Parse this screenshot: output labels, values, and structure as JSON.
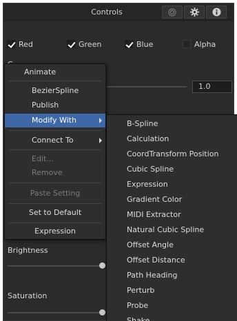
{
  "header": {
    "title": "Controls",
    "buttons": [
      "circles-icon",
      "gear-icon",
      "info-icon"
    ]
  },
  "channels": {
    "red": {
      "label": "Red",
      "checked": true
    },
    "green": {
      "label": "Green",
      "checked": true
    },
    "blue": {
      "label": "Blue",
      "checked": true
    },
    "alpha": {
      "label": "Alpha",
      "checked": false
    }
  },
  "partial_label": "C",
  "value_field": "1.0",
  "sections": {
    "brightness": "Brightness",
    "saturation": "Saturation"
  },
  "context_menu": {
    "animate": "Animate",
    "bezier_spline": "BezierSpline",
    "publish": "Publish",
    "modify_with": "Modify With",
    "connect_to": "Connect To",
    "edit": "Edit...",
    "remove": "Remove",
    "paste_setting": "Paste Setting",
    "set_to_default": "Set to Default",
    "expression": "Expression"
  },
  "submenu": {
    "items": [
      "B-Spline",
      "Calculation",
      "CoordTransform Position",
      "Cubic Spline",
      "Expression",
      "Gradient Color",
      "MIDI Extractor",
      "Natural Cubic Spline",
      "Offset Angle",
      "Offset Distance",
      "Path Heading",
      "Perturb",
      "Probe",
      "Shake"
    ]
  },
  "colors": {
    "panel_bg": "#2b2b2b",
    "highlight": "#3f68a9",
    "text": "#dcdcdc",
    "disabled_text": "#7b7b7b"
  }
}
